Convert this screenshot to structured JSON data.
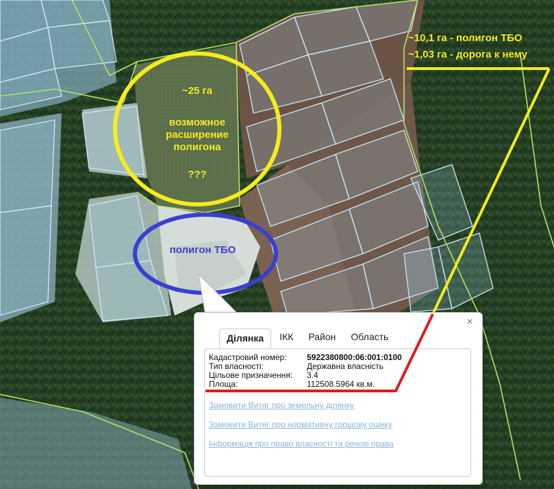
{
  "map": {
    "annotations": {
      "yellow_circle_lines": [
        "~25 га",
        "возможное",
        "расширение",
        "полигона",
        "???"
      ],
      "blue_circle_label": "полигон ТБО",
      "top_right_lines": [
        "~10,1 га - полигон ТБО",
        "~1,03 га - дорога к нему"
      ]
    },
    "colors": {
      "annotation_yellow": "#f4ec1d",
      "annotation_blue": "#3b3fd0",
      "leader_red": "#e01b1b",
      "parcel_outline": "#9fd0ef",
      "boundary_green": "#b6e36a"
    }
  },
  "popup": {
    "close_icon": "×",
    "tabs": [
      "Ділянка",
      "ІКК",
      "Район",
      "Область"
    ],
    "active_tab": "Ділянка",
    "attributes": [
      {
        "key": "Кадастровий номер:",
        "value": "5922380800:06:001:0100"
      },
      {
        "key": "Тип власності:",
        "value": "Державна власність"
      },
      {
        "key": "Цільове призначення:",
        "value": "3.4"
      },
      {
        "key": "Площа:",
        "value": "112508.5964 кв.м."
      }
    ],
    "links": [
      "Замовити Витяг про земельну ділянку",
      "Замовити Витяг про нормативну грошову оцінку",
      "Інформація про право власності та речові права"
    ]
  }
}
